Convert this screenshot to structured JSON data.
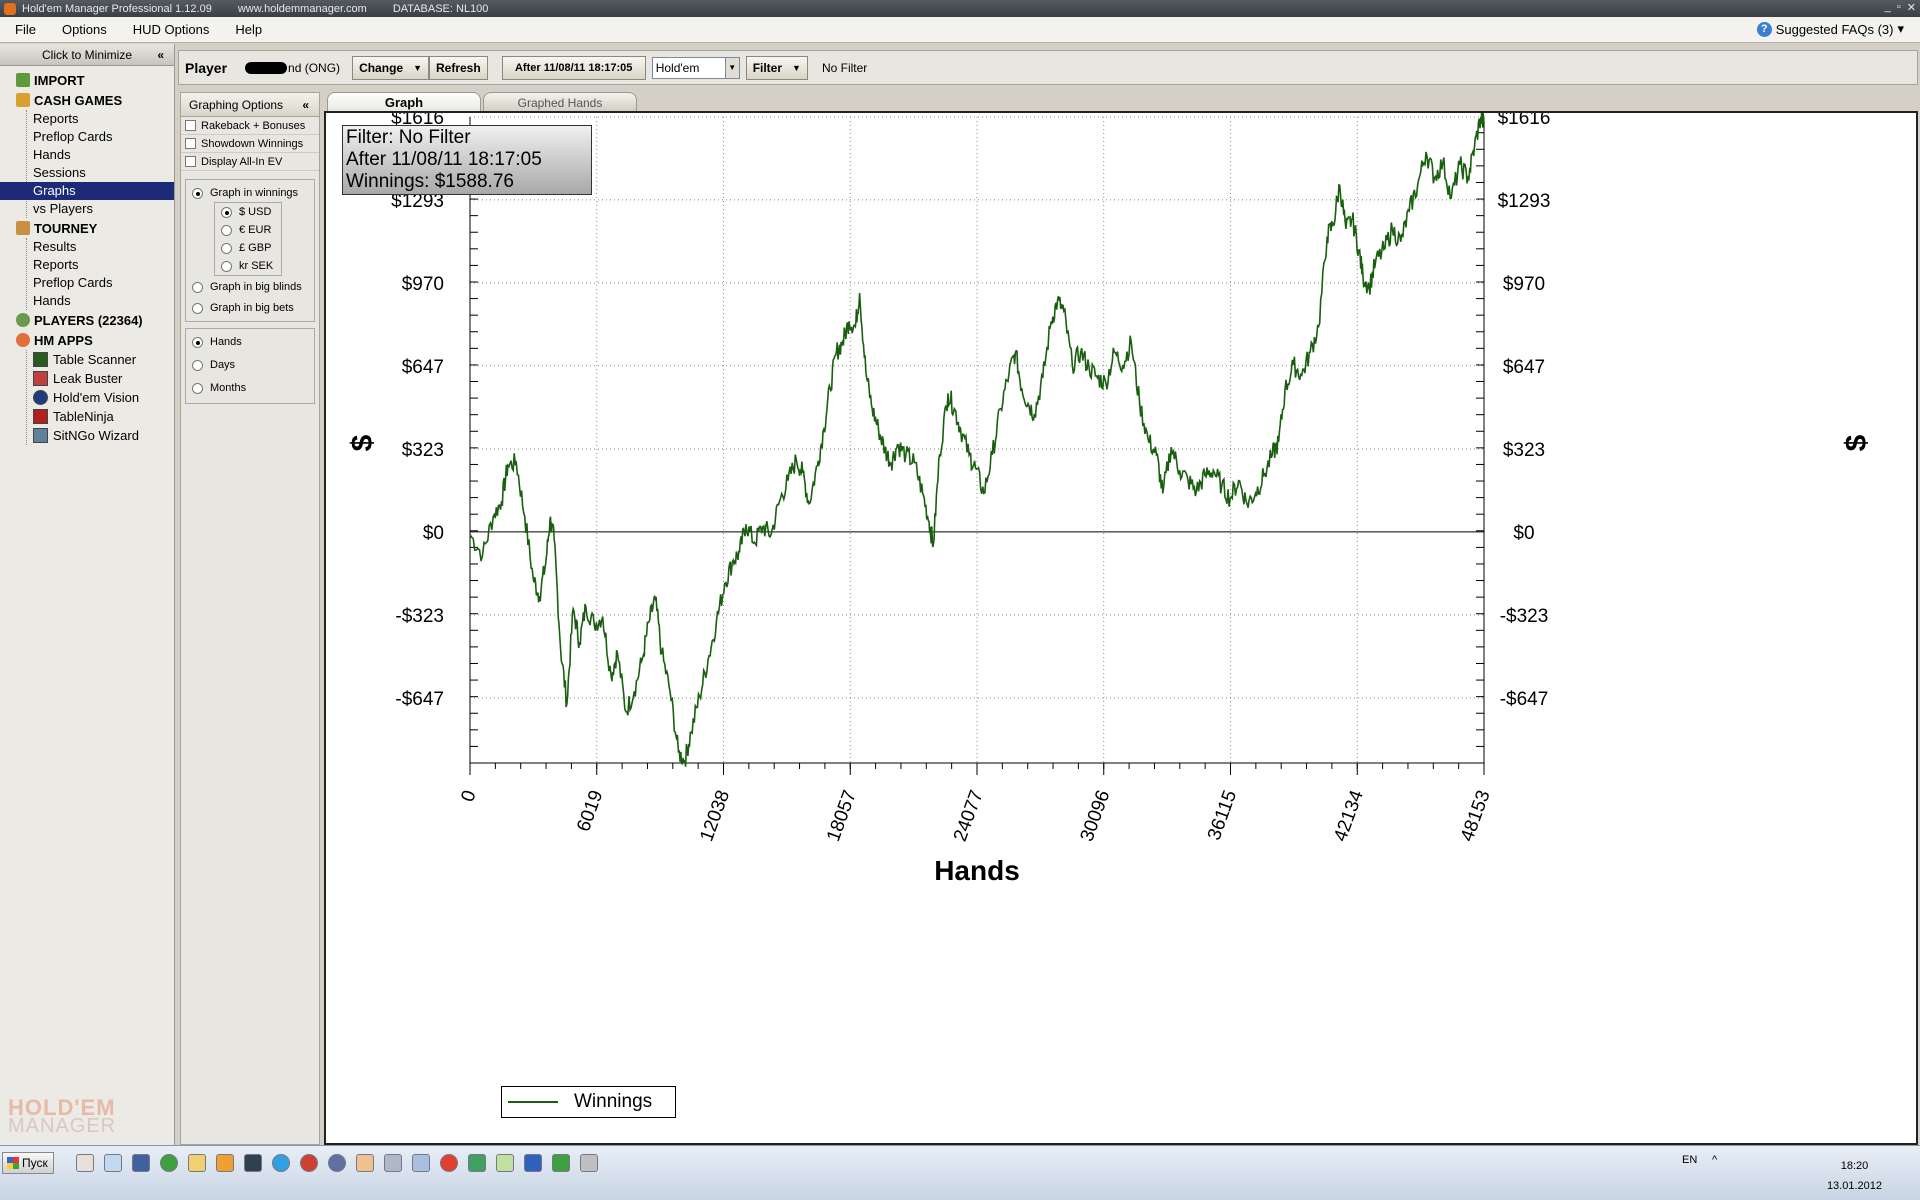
{
  "window": {
    "title": "Hold'em Manager Professional 1.12.09",
    "website": "www.holdemmanager.com",
    "database": "DATABASE: NL100"
  },
  "menu": {
    "items": [
      "File",
      "Options",
      "HUD Options",
      "Help"
    ],
    "faq": "Suggested FAQs (3)"
  },
  "sidebar": {
    "minimize_label": "Click to Minimize",
    "import": "IMPORT",
    "cash_games": {
      "label": "CASH GAMES",
      "items": [
        "Reports",
        "Preflop Cards",
        "Hands",
        "Sessions",
        "Graphs",
        "vs Players"
      ]
    },
    "tourney": {
      "label": "TOURNEY",
      "items": [
        "Results",
        "Reports",
        "Preflop Cards",
        "Hands"
      ]
    },
    "players": "PLAYERS (22364)",
    "hm_apps": {
      "label": "HM APPS",
      "items": [
        "Table Scanner",
        "Leak Buster",
        "Hold'em Vision",
        "TableNinja",
        "SitNGo Wizard"
      ]
    },
    "logo_top": "HOLD'EM",
    "logo_bottom": "MANAGER"
  },
  "playerbar": {
    "player_label": "Player",
    "player_suffix": "nd (ONG)",
    "change": "Change",
    "refresh": "Refresh",
    "date_filter": "After 11/08/11 18:17:05",
    "game": "Hold'em",
    "filter": "Filter",
    "filter_status": "No Filter"
  },
  "graphing_options": {
    "title": "Graphing Options",
    "checkboxes": [
      "Rakeback + Bonuses",
      "Showdown Winnings",
      "Display All-In EV"
    ],
    "graph_in_winnings": "Graph in winnings",
    "currencies": [
      "$ USD",
      "€ EUR",
      "£ GBP",
      "kr SEK"
    ],
    "graph_in_big_blinds": "Graph in big blinds",
    "graph_in_big_bets": "Graph in big bets",
    "x_units": [
      "Hands",
      "Days",
      "Months"
    ]
  },
  "tabs": [
    "Graph",
    "Graphed Hands"
  ],
  "filter_box": {
    "line1": "Filter: No Filter",
    "line2": "After 11/08/11 18:17:05",
    "line3": "Winnings: $1588.76"
  },
  "chart_data": {
    "type": "line",
    "xlabel": "Hands",
    "ylabel": "$",
    "xlim": [
      0,
      48153
    ],
    "ylim": [
      -900,
      1616
    ],
    "x_ticks": [
      "0",
      "6019",
      "12038",
      "18057",
      "24077",
      "30096",
      "36115",
      "42134",
      "48153"
    ],
    "y_ticks": [
      "$1616",
      "$1293",
      "$970",
      "$647",
      "$323",
      "$0",
      "-$323",
      "-$647"
    ],
    "y_tick_values": [
      1616,
      1293,
      970,
      647,
      323,
      0,
      -323,
      -647
    ],
    "grid": true,
    "legend_position": "bottom-left",
    "series_color": "#1a5e10",
    "series": [
      {
        "name": "Winnings",
        "points": [
          [
            0,
            -10
          ],
          [
            600,
            -90
          ],
          [
            1100,
            60
          ],
          [
            1500,
            120
          ],
          [
            1800,
            260
          ],
          [
            2200,
            270
          ],
          [
            2600,
            60
          ],
          [
            3000,
            -180
          ],
          [
            3300,
            -250
          ],
          [
            3600,
            -120
          ],
          [
            3800,
            50
          ],
          [
            4000,
            -30
          ],
          [
            4300,
            -450
          ],
          [
            4600,
            -670
          ],
          [
            4900,
            -300
          ],
          [
            5200,
            -430
          ],
          [
            5500,
            -290
          ],
          [
            5900,
            -360
          ],
          [
            6300,
            -330
          ],
          [
            6700,
            -560
          ],
          [
            7000,
            -470
          ],
          [
            7400,
            -700
          ],
          [
            7800,
            -620
          ],
          [
            8200,
            -490
          ],
          [
            8500,
            -350
          ],
          [
            8800,
            -260
          ],
          [
            9100,
            -470
          ],
          [
            9500,
            -620
          ],
          [
            9900,
            -860
          ],
          [
            10200,
            -890
          ],
          [
            10500,
            -780
          ],
          [
            10900,
            -640
          ],
          [
            11300,
            -500
          ],
          [
            11700,
            -350
          ],
          [
            12100,
            -200
          ],
          [
            12500,
            -110
          ],
          [
            12800,
            -80
          ],
          [
            13100,
            30
          ],
          [
            13500,
            -40
          ],
          [
            13900,
            20
          ],
          [
            14300,
            -10
          ],
          [
            14700,
            120
          ],
          [
            15100,
            200
          ],
          [
            15500,
            280
          ],
          [
            15800,
            230
          ],
          [
            16100,
            110
          ],
          [
            16500,
            260
          ],
          [
            16800,
            400
          ],
          [
            17100,
            560
          ],
          [
            17400,
            700
          ],
          [
            17700,
            740
          ],
          [
            18000,
            820
          ],
          [
            18300,
            800
          ],
          [
            18500,
            930
          ],
          [
            18800,
            620
          ],
          [
            19100,
            480
          ],
          [
            19400,
            400
          ],
          [
            19700,
            320
          ],
          [
            20000,
            270
          ],
          [
            20300,
            340
          ],
          [
            20700,
            300
          ],
          [
            21100,
            270
          ],
          [
            21500,
            150
          ],
          [
            21800,
            40
          ],
          [
            22000,
            -50
          ],
          [
            22300,
            300
          ],
          [
            22700,
            540
          ],
          [
            23000,
            480
          ],
          [
            23300,
            400
          ],
          [
            23700,
            300
          ],
          [
            24000,
            250
          ],
          [
            24400,
            150
          ],
          [
            24800,
            300
          ],
          [
            25200,
            480
          ],
          [
            25600,
            620
          ],
          [
            25900,
            700
          ],
          [
            26200,
            560
          ],
          [
            26500,
            500
          ],
          [
            26800,
            460
          ],
          [
            27200,
            600
          ],
          [
            27600,
            820
          ],
          [
            27900,
            900
          ],
          [
            28200,
            860
          ],
          [
            28600,
            650
          ],
          [
            29000,
            700
          ],
          [
            29400,
            640
          ],
          [
            29800,
            600
          ],
          [
            30200,
            580
          ],
          [
            30600,
            700
          ],
          [
            31000,
            650
          ],
          [
            31400,
            740
          ],
          [
            31800,
            500
          ],
          [
            32200,
            360
          ],
          [
            32600,
            300
          ],
          [
            32900,
            150
          ],
          [
            33300,
            330
          ],
          [
            33700,
            240
          ],
          [
            34100,
            200
          ],
          [
            34500,
            160
          ],
          [
            34900,
            220
          ],
          [
            35300,
            240
          ],
          [
            35700,
            180
          ],
          [
            36100,
            130
          ],
          [
            36500,
            200
          ],
          [
            36900,
            110
          ],
          [
            37300,
            150
          ],
          [
            37700,
            220
          ],
          [
            38100,
            300
          ],
          [
            38400,
            350
          ],
          [
            38700,
            550
          ],
          [
            39100,
            650
          ],
          [
            39500,
            610
          ],
          [
            39900,
            700
          ],
          [
            40300,
            800
          ],
          [
            40700,
            1150
          ],
          [
            41000,
            1200
          ],
          [
            41300,
            1350
          ],
          [
            41600,
            1180
          ],
          [
            41900,
            1220
          ],
          [
            42200,
            1100
          ],
          [
            42400,
            1000
          ],
          [
            42700,
            950
          ],
          [
            43000,
            1050
          ],
          [
            43400,
            1100
          ],
          [
            43800,
            1180
          ],
          [
            44200,
            1130
          ],
          [
            44600,
            1250
          ],
          [
            45000,
            1350
          ],
          [
            45400,
            1480
          ],
          [
            45800,
            1380
          ],
          [
            46200,
            1440
          ],
          [
            46600,
            1300
          ],
          [
            47000,
            1430
          ],
          [
            47400,
            1380
          ],
          [
            47700,
            1500
          ],
          [
            48000,
            1616
          ],
          [
            48153,
            1588.76
          ]
        ]
      }
    ]
  },
  "taskbar": {
    "start_label": "Пуск",
    "lang": "EN",
    "time": "18:20",
    "date": "13.01.2012"
  }
}
